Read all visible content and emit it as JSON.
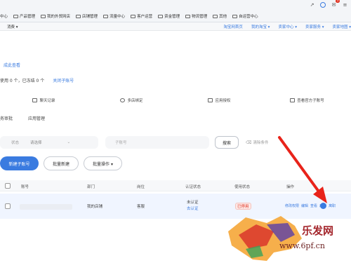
{
  "browser": {
    "bookmarks": [
      "中心",
      "产品管理",
      "我的外贸网店",
      "店铺管理",
      "流量中心",
      "客户运营",
      "资金管理",
      "物流管理",
      "其他",
      "自运营中心"
    ],
    "notification_count": "5"
  },
  "site": {
    "left_text": "消费 ▾",
    "links": [
      "淘宝网首页",
      "我的淘宝 ▾",
      "卖家中心 ▾",
      "卖家服务 ▾",
      "卖家地图 ▾"
    ]
  },
  "main": {
    "view_link": "成此查看",
    "usage_text": "使用 0 个，已冻结 0 个",
    "manage_link": "关闭子账号",
    "tiles": [
      "聊天记录",
      "多店绑定",
      "应用授权",
      "查看官方子账号"
    ],
    "tabs": [
      "务审批",
      "应用管理"
    ]
  },
  "filters": {
    "status_label": "状态",
    "status_placeholder": "请选择",
    "sub_placeholder": "子账号",
    "search_label": "搜索",
    "clear_label": "清除条件"
  },
  "actions": {
    "new_label": "新建子账号",
    "batch_new_label": "批量新建",
    "batch_ops_label": "批量操作 ▾"
  },
  "table": {
    "headers": [
      "账号",
      "部门",
      "岗位",
      "认证状态",
      "使用状态",
      "操作"
    ],
    "rows": [
      {
        "dept": "我的店铺",
        "role": "客服",
        "auth": "未认证",
        "auth_sub": "去认证",
        "status": "已停用",
        "ops": [
          "修改权限",
          "编辑",
          "查看",
          "启用",
          "离职"
        ]
      }
    ]
  },
  "watermark": {
    "brand": "乐发网",
    "url": "www.6pf.cn"
  }
}
